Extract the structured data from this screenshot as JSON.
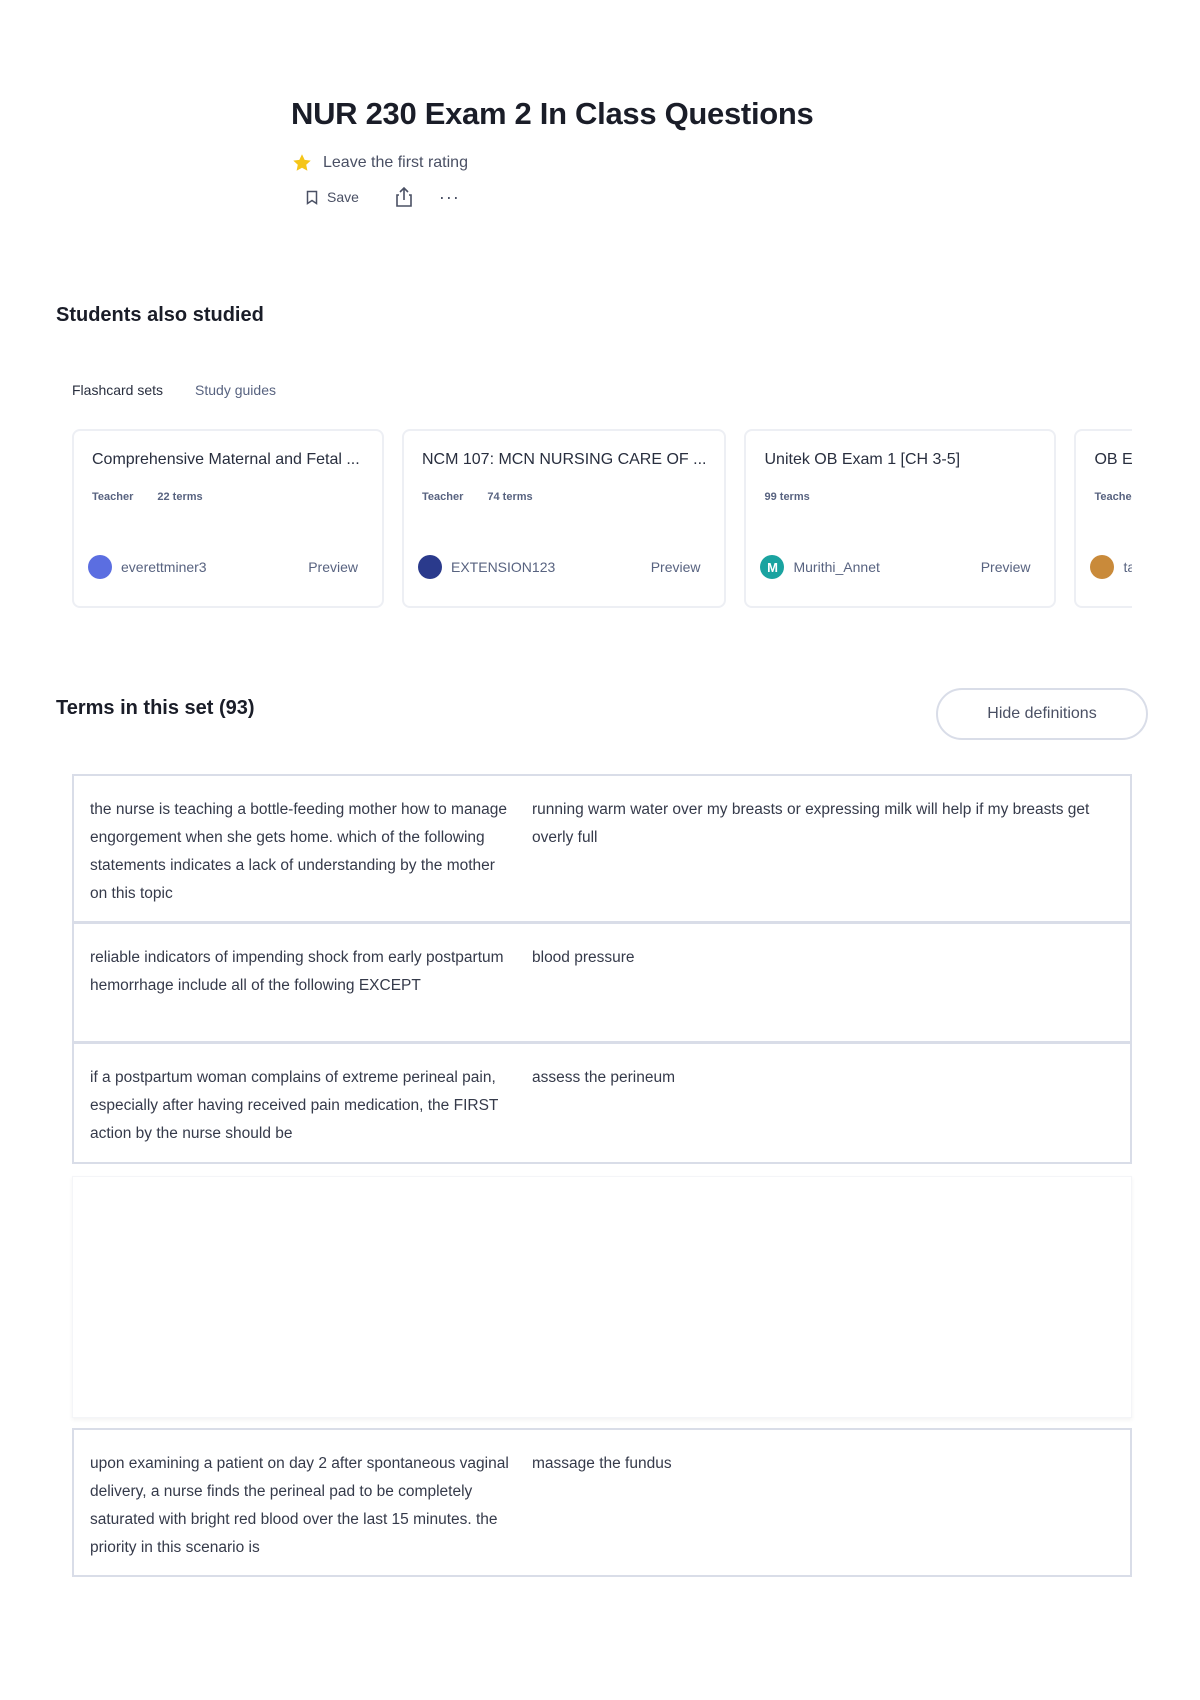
{
  "header": {
    "title": "NUR 230 Exam 2 In Class Questions",
    "rating_text": "Leave the first rating",
    "save_label": "Save",
    "more_label": "···"
  },
  "also_studied": {
    "title": "Students also studied",
    "tabs": [
      {
        "label": "Flashcard sets",
        "active": true
      },
      {
        "label": "Study guides",
        "active": false
      }
    ],
    "cards": [
      {
        "title": "Comprehensive Maternal and Fetal ...",
        "badge": "Teacher",
        "terms": "22 terms",
        "author": "everettminer3",
        "avatar_color": "#5b6ee1",
        "avatar_letter": "",
        "preview": "Preview"
      },
      {
        "title": "NCM 107: MCN NURSING CARE OF ...",
        "badge": "Teacher",
        "terms": "74 terms",
        "author": "EXTENSION123",
        "avatar_color": "#2a3a8c",
        "avatar_letter": "",
        "preview": "Preview"
      },
      {
        "title": "Unitek OB Exam 1 [CH 3-5]",
        "badge": "",
        "terms": "99 terms",
        "author": "Murithi_Annet",
        "avatar_color": "#1aa3a0",
        "avatar_letter": "M",
        "preview": "Preview"
      },
      {
        "title": "OB Exa",
        "badge": "Teacher",
        "terms": "",
        "author": "tan",
        "avatar_color": "#c98a3a",
        "avatar_letter": "",
        "preview": ""
      }
    ]
  },
  "terms_section": {
    "title": "Terms in this set (93)",
    "hide_label": "Hide definitions",
    "rows": [
      {
        "term": "the nurse is teaching a bottle-feeding mother how to manage engorgement when she gets home. which of the following statements indicates a lack of understanding by the mother on this topic",
        "definition": "running warm water over my breasts or expressing milk will help if my breasts get overly full"
      },
      {
        "term": "reliable indicators of impending shock from early postpartum hemorrhage include all of the following EXCEPT",
        "definition": "blood pressure"
      },
      {
        "term": "if a postpartum woman complains of extreme perineal pain, especially after having received pain medication, the FIRST action by the nurse should be",
        "definition": "assess the perineum"
      },
      {
        "term": "upon examining a patient on day 2 after spontaneous vaginal delivery, a nurse finds the perineal pad to be completely saturated with bright red blood over the last 15 minutes. the priority in this scenario is",
        "definition": "massage the fundus"
      }
    ]
  },
  "colors": {
    "star": "#f5c518",
    "border": "#d9dde8",
    "text_secondary": "#586380"
  },
  "icons": [
    "star-icon",
    "bookmark-icon",
    "share-icon",
    "more-icon"
  ]
}
